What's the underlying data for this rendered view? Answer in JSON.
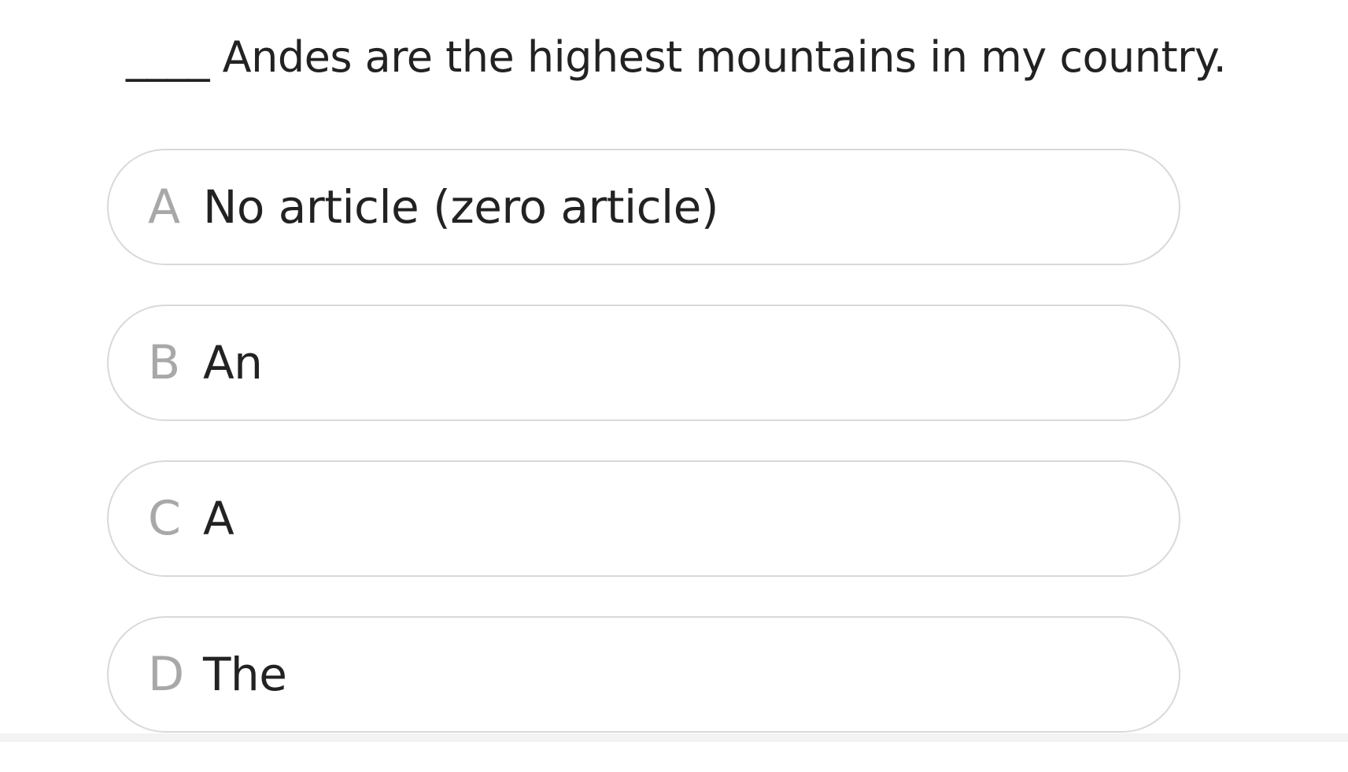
{
  "question": {
    "text": "____ Andes are the highest mountains in my country."
  },
  "options": [
    {
      "letter": "A",
      "text": "No article (zero article)"
    },
    {
      "letter": "B",
      "text": "An"
    },
    {
      "letter": "C",
      "text": "A"
    },
    {
      "letter": "D",
      "text": "The"
    }
  ],
  "colors": {
    "text": "#222222",
    "option_letter": "#a8a8a8",
    "option_border": "#d9d9d9",
    "background": "#ffffff"
  }
}
